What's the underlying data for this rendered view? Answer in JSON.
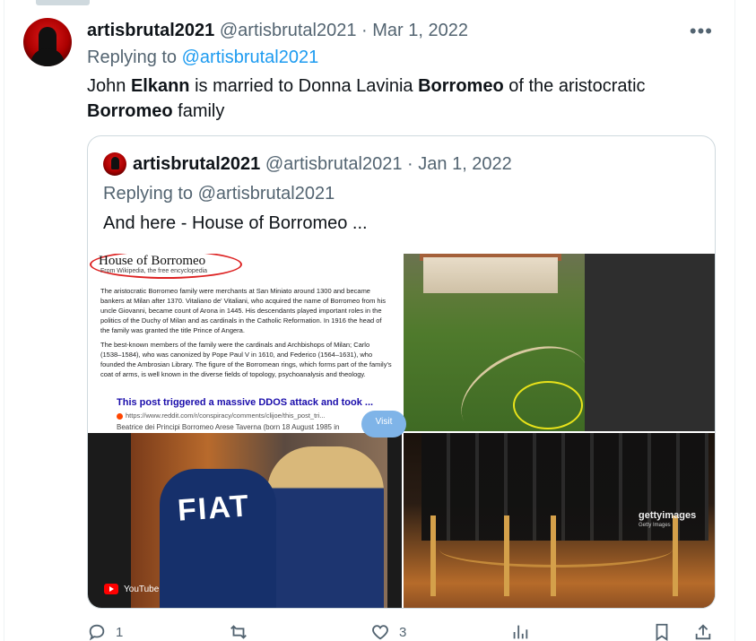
{
  "tweet": {
    "display_name": "artisbrutal2021",
    "handle": "@artisbrutal2021",
    "separator": "·",
    "date": "Mar 1, 2022",
    "more_icon": "more-icon",
    "replying_prefix": "Replying to",
    "replying_to": "@artisbrutal2021",
    "text_parts": [
      "John ",
      "Elkann",
      " is married to Donna Lavinia ",
      "Borromeo",
      " of the aristocratic ",
      "Borromeo",
      " family"
    ]
  },
  "quote": {
    "display_name": "artisbrutal2021",
    "handle": "@artisbrutal2021",
    "separator": "·",
    "date": "Jan 1, 2022",
    "replying_prefix": "Replying to",
    "replying_to": "@artisbrutal2021",
    "text": "And here - House of Borromeo ..."
  },
  "media": {
    "wiki": {
      "title": "House of Borromeo",
      "subtitle": "From Wikipedia, the free encyclopedia",
      "paragraph1": "The aristocratic Borromeo family were merchants at San Miniato around 1300 and became bankers at Milan after 1370. Vitaliano de' Vitaliani, who acquired the name of Borromeo from his uncle Giovanni, became count of Arona in 1445. His descendants played important roles in the politics of the Duchy of Milan and as cardinals in the Catholic Reformation. In 1916 the head of the family was granted the title Prince of Angera.",
      "paragraph2": "The best-known members of the family were the cardinals and Archbishops of Milan; Carlo (1538–1584), who was canonized by Pope Paul V in 1610, and Federico (1564–1631), who founded the Ambrosian Library. The figure of the Borromean rings, which forms part of the family's coat of arms, is well known in the diverse fields of topology, psychoanalysis and theology.",
      "link_title": "This post triggered a massive DDOS attack and took ...",
      "link_url": "https://www.reddit.com/r/conspiracy/comments/clijoe/this_post_tri...",
      "footer": "Beatrice dei Principi Borromeo Arese Taverna (born 18 August 1985 in"
    },
    "fiat": {
      "word": "FIAT",
      "source": "YouTube",
      "visit": "Visit"
    },
    "getty": {
      "brand": "gettyimages",
      "credit": "Getty Images"
    }
  },
  "actions": {
    "reply_icon": "reply-icon",
    "reply_count": "1",
    "retweet_icon": "retweet-icon",
    "like_icon": "heart-icon",
    "like_count": "3",
    "views_icon": "views-icon",
    "bookmark_icon": "bookmark-icon",
    "share_icon": "share-icon"
  },
  "colors": {
    "link": "#1d9bf0",
    "secondary_text": "#536471",
    "primary_text": "#0f1419",
    "border": "#cfd9de"
  }
}
